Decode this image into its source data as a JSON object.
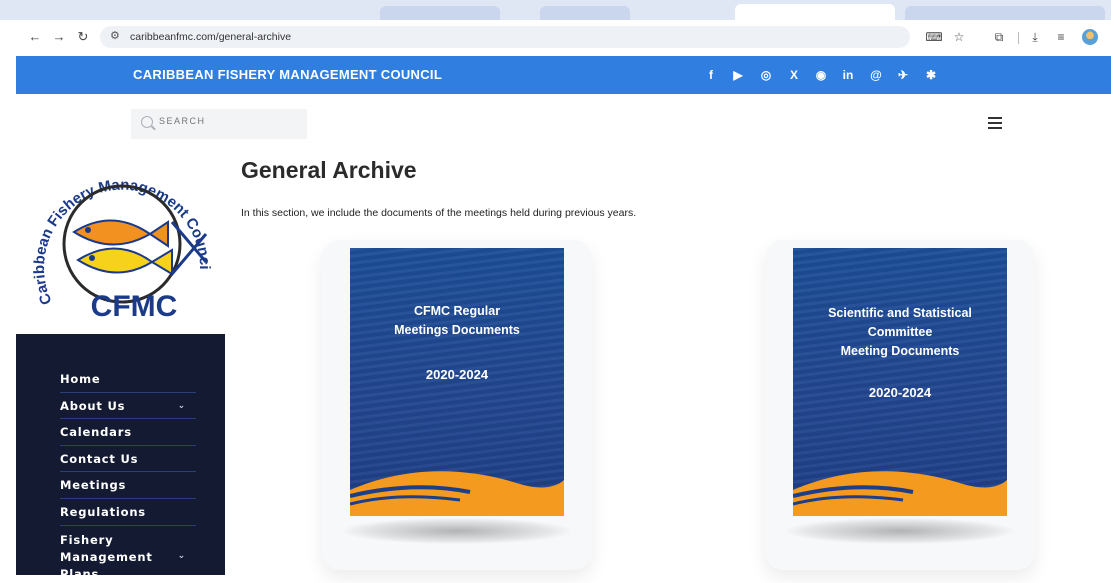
{
  "browser": {
    "url": "caribbeanfmc.com/general-archive"
  },
  "site": {
    "title": "CARIBBEAN FISHERY MANAGEMENT COUNCIL",
    "social": [
      {
        "name": "facebook-icon",
        "glyph": "f"
      },
      {
        "name": "youtube-icon",
        "glyph": "▶"
      },
      {
        "name": "instagram-icon",
        "glyph": "◎"
      },
      {
        "name": "x-icon",
        "glyph": "X"
      },
      {
        "name": "threads-icon",
        "glyph": "◉"
      },
      {
        "name": "linkedin-icon",
        "glyph": "in"
      },
      {
        "name": "threads-alt-icon",
        "glyph": "@"
      },
      {
        "name": "bluesky-icon",
        "glyph": "✈"
      },
      {
        "name": "sparkle-icon",
        "glyph": "✱"
      }
    ],
    "brand_color": "#2f7ee0"
  },
  "search": {
    "placeholder": "SEARCH"
  },
  "logo": {
    "ring_text": "Caribbean Fishery Management Council",
    "acronym": "CFMC"
  },
  "sidebar": {
    "items": [
      {
        "label": "Home",
        "has_submenu": false
      },
      {
        "label": "About Us",
        "has_submenu": true
      },
      {
        "label": "Calendars",
        "has_submenu": false
      },
      {
        "label": "Contact Us",
        "has_submenu": false
      },
      {
        "label": "Meetings",
        "has_submenu": false
      },
      {
        "label": "Regulations",
        "has_submenu": false
      }
    ],
    "fmp_line1": "Fishery",
    "fmp_line2": "Management",
    "fmp_line3": "Plans"
  },
  "main": {
    "title": "General Archive",
    "intro": "In this section, we include the documents of the meetings held during previous years.",
    "cards": [
      {
        "line1": "CFMC Regular",
        "line2": "Meetings Documents",
        "years": "2020-2024"
      },
      {
        "line1": "Scientific and Statistical",
        "line2": "Committee",
        "line3": "Meeting Documents",
        "years": "2020-2024"
      }
    ]
  }
}
